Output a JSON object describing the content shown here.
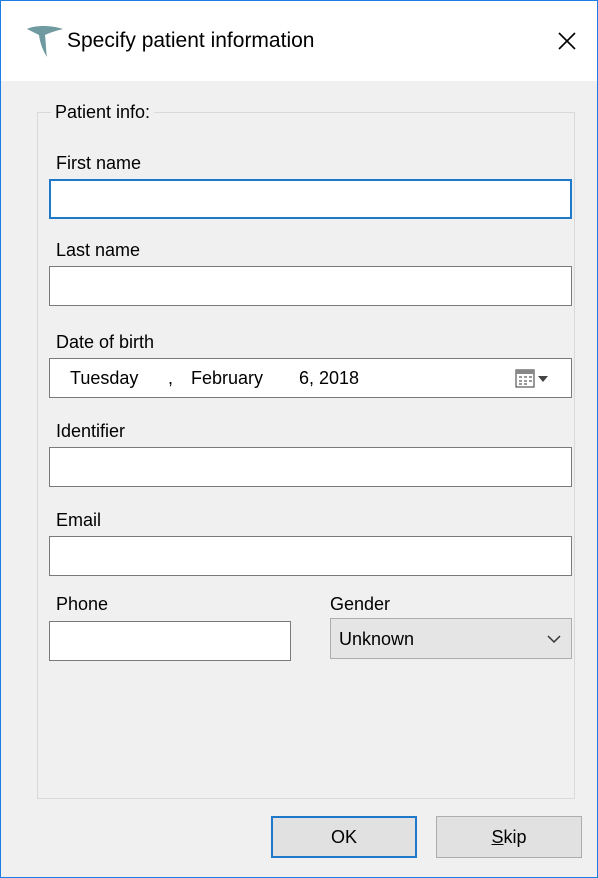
{
  "window": {
    "title": "Specify patient information",
    "close_icon": "close-icon",
    "app_icon": "tooth-logo-icon"
  },
  "group": {
    "label": "Patient info:"
  },
  "fields": {
    "first_name": {
      "label": "First name",
      "value": ""
    },
    "last_name": {
      "label": "Last name",
      "value": ""
    },
    "date_of_birth": {
      "label": "Date of birth",
      "weekday": "Tuesday",
      "sep": ",",
      "month": "February",
      "day_year": "6, 2018",
      "icon": "calendar-dropdown-icon"
    },
    "identifier": {
      "label": "Identifier",
      "value": ""
    },
    "email": {
      "label": "Email",
      "value": ""
    },
    "phone": {
      "label": "Phone",
      "value": ""
    },
    "gender": {
      "label": "Gender",
      "selected": "Unknown",
      "icon": "chevron-down-icon"
    }
  },
  "buttons": {
    "ok": "OK",
    "skip_first": "S",
    "skip_rest": "kip"
  },
  "colors": {
    "focus": "#1f78c8",
    "window_border": "#1d7ce6",
    "dialog_bg": "#f0f0f0"
  }
}
